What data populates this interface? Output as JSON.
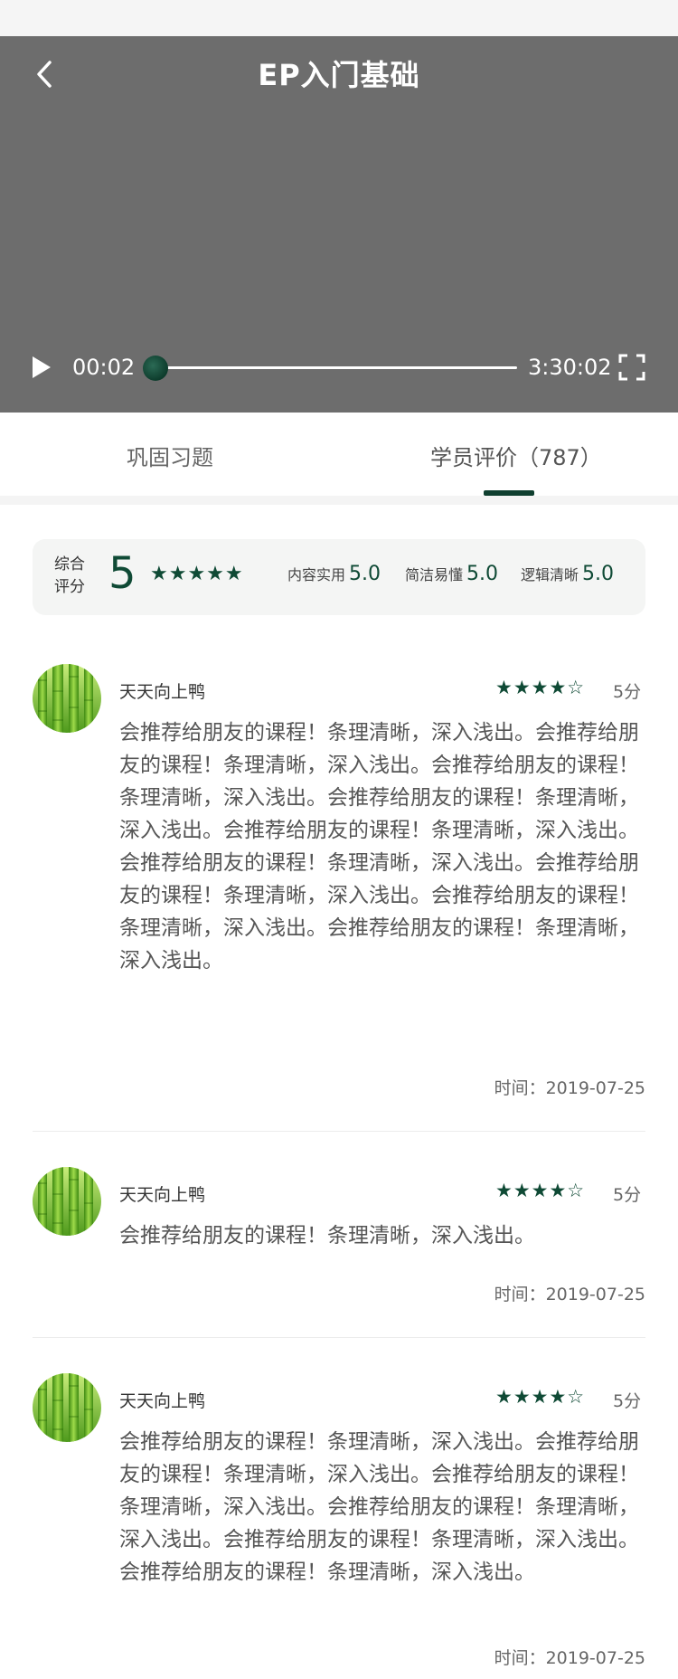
{
  "header": {
    "title": "EP入门基础"
  },
  "player": {
    "current_time": "00:02",
    "total_time": "3:30:02",
    "progress": 0.0,
    "play_icon": "play-icon",
    "fullscreen_icon": "fullscreen-icon",
    "back_icon": "chevron-left-icon"
  },
  "tabs": [
    {
      "label": "巩固习题",
      "active": false
    },
    {
      "label": "学员评价（787）",
      "active": true
    }
  ],
  "summary": {
    "label": "综合评分",
    "score": "5",
    "stars": "★★★★★",
    "subs": [
      {
        "name": "内容实用",
        "value": "5.0"
      },
      {
        "name": "简洁易懂",
        "value": "5.0"
      },
      {
        "name": "逻辑清晰",
        "value": "5.0"
      }
    ]
  },
  "reviews": [
    {
      "user": "天天向上鸭",
      "stars": "★★★★☆",
      "score": "5分",
      "text": "会推荐给朋友的课程！条理清晰，深入浅出。会推荐给朋友的课程！条理清晰，深入浅出。会推荐给朋友的课程！条理清晰，深入浅出。会推荐给朋友的课程！条理清晰，深入浅出。会推荐给朋友的课程！条理清晰，深入浅出。会推荐给朋友的课程！条理清晰，深入浅出。会推荐给朋友的课程！条理清晰，深入浅出。会推荐给朋友的课程！条理清晰，深入浅出。会推荐给朋友的课程！条理清晰，深入浅出。",
      "time": "时间：2019-07-25"
    },
    {
      "user": "天天向上鸭",
      "stars": "★★★★☆",
      "score": "5分",
      "text": "会推荐给朋友的课程！条理清晰，深入浅出。",
      "time": "时间：2019-07-25"
    },
    {
      "user": "天天向上鸭",
      "stars": "★★★★☆",
      "score": "5分",
      "text": "会推荐给朋友的课程！条理清晰，深入浅出。会推荐给朋友的课程！条理清晰，深入浅出。会推荐给朋友的课程！条理清晰，深入浅出。会推荐给朋友的课程！条理清晰，深入浅出。会推荐给朋友的课程！条理清晰，深入浅出。会推荐给朋友的课程！条理清晰，深入浅出。",
      "time": "时间：2019-07-25"
    }
  ],
  "colors": {
    "accent": "#0f4a35",
    "player_bg": "#6d6d6d"
  }
}
